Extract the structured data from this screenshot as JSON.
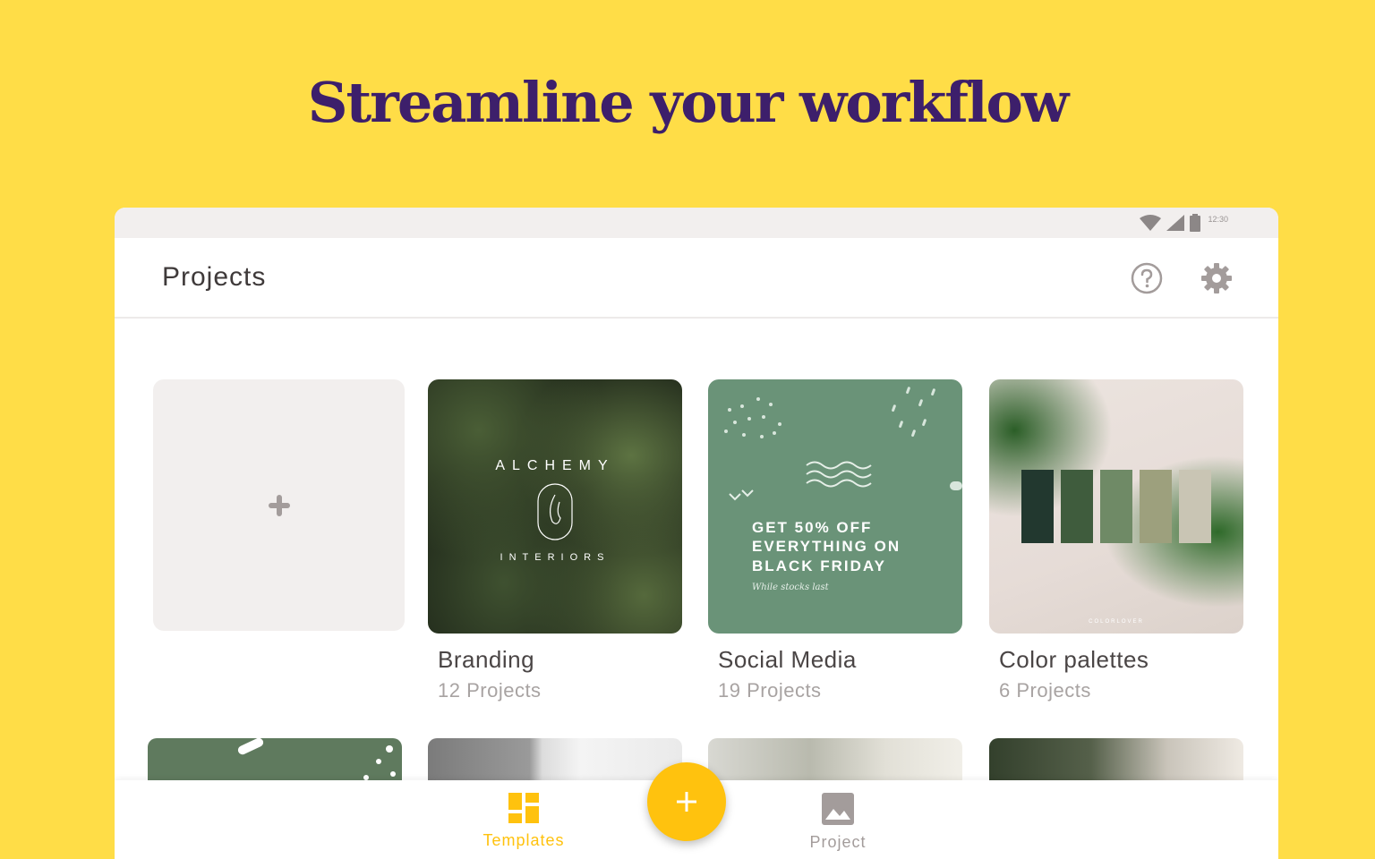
{
  "headline": "Streamline your workflow",
  "status_bar": {
    "time": "12:30"
  },
  "app_bar": {
    "title": "Projects",
    "help_icon": "help-circle-icon",
    "settings_icon": "gear-icon"
  },
  "new_project": {
    "icon": "plus-icon"
  },
  "cards": [
    {
      "title": "Branding",
      "count": "12 Projects",
      "thumb_text_top": "ALCHEMY",
      "thumb_text_bottom": "INTERIORS"
    },
    {
      "title": "Social Media",
      "count": "19 Projects",
      "thumb_lines": [
        "GET 50% OFF",
        "EVERYTHING ON",
        "BLACK FRIDAY"
      ],
      "thumb_note": "While stocks last"
    },
    {
      "title": "Color palettes",
      "count": "6 Projects",
      "thumb_mark": "COLORLOVER",
      "swatches": [
        "#22382F",
        "#3F5C3D",
        "#6F8A66",
        "#9DA07D",
        "#C9C5B4"
      ]
    }
  ],
  "bottom_nav": {
    "templates_label": "Templates",
    "project_label": "Project",
    "templates_icon": "grid-icon",
    "project_icon": "image-icon",
    "fab_icon": "plus-icon"
  },
  "colors": {
    "background": "#FFDD47",
    "headline": "#3D1F6B",
    "accent": "#FFC20E",
    "muted": "#A8A3A2"
  }
}
